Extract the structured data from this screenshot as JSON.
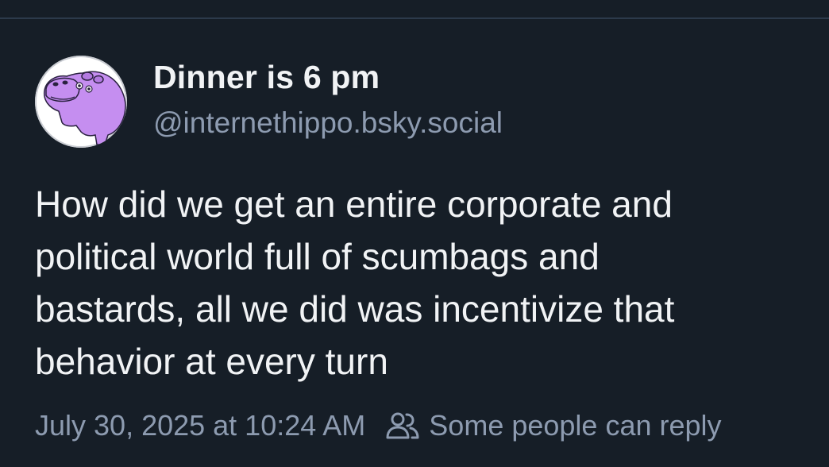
{
  "post": {
    "author": {
      "display_name": "Dinner is 6 pm",
      "handle": "@internethippo.bsky.social",
      "avatar_icon": "purple-hippo-avatar"
    },
    "text_lines": [
      "How did we get an entire corporate and",
      "political world full of scumbags and",
      "bastards, all we did was incentivize that",
      "behavior at every turn"
    ],
    "timestamp": "July 30, 2025 at 10:24 AM",
    "reply_settings": {
      "icon": "people-icon",
      "label": "Some people can reply"
    }
  },
  "colors": {
    "background": "#161e27",
    "text_primary": "#f1f3f5",
    "text_secondary": "#8d9bb0",
    "divider": "#2c3a4b",
    "hippo_purple": "#c58ef0"
  }
}
